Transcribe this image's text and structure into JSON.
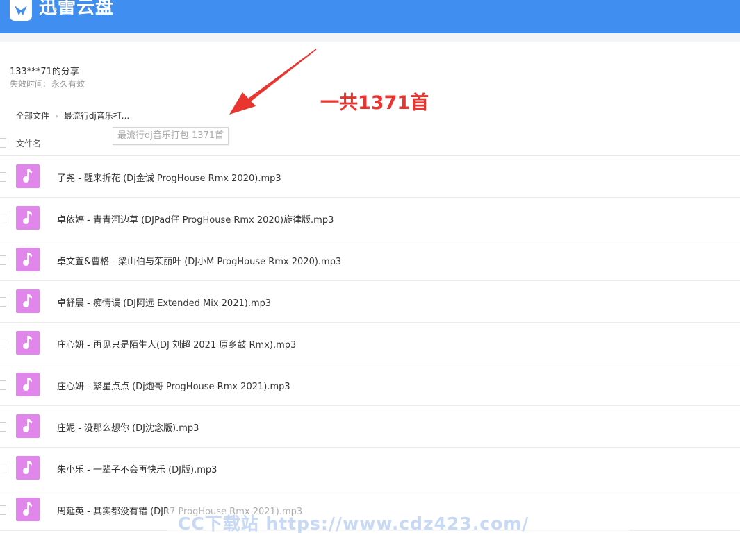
{
  "app": {
    "title": "迅雷云盘"
  },
  "share": {
    "owner_title": "133***71的分享",
    "expire_label": "失效时间:",
    "expire_value": "永久有效"
  },
  "annotation": {
    "text": "一共1371首",
    "color": "#e8352f"
  },
  "breadcrumb": {
    "root": "全部文件",
    "current": "最流行dj音乐打..."
  },
  "tooltip": {
    "text": "最流行dj音乐打包 1371首"
  },
  "list_header": {
    "name_col": "文件名"
  },
  "files": [
    {
      "name": "子尧 - 醒来折花 (Dj金诚 ProgHouse Rmx 2020).mp3"
    },
    {
      "name": "卓依婷 - 青青河边草 (DJPad仔 ProgHouse Rmx 2020)旋律版.mp3"
    },
    {
      "name": "卓文萱&曹格 - 梁山伯与茱丽叶 (DJ小M ProgHouse Rmx 2020).mp3"
    },
    {
      "name": "卓舒晨 - 痴情误 (DJ阿远 Extended Mix 2021).mp3"
    },
    {
      "name": "庄心妍 - 再见只是陌生人(DJ 刘超 2021 原乡鼓 Rmx).mp3"
    },
    {
      "name": "庄心妍 - 繁星点点 (Dj炮哥 ProgHouse Rmx 2021).mp3"
    },
    {
      "name": "庄妮 - 没那么想你 (DJ沈念版).mp3"
    },
    {
      "name": "朱小乐 - 一辈子不会再快乐 (DJ版).mp3"
    },
    {
      "name": "周延英 - 其实都没有错 (DJR7 ProgHouse Rmx 2021).mp3"
    }
  ],
  "watermark": {
    "text": "CC下载站 https://www.cdz423.com/"
  },
  "colors": {
    "topbar": "#3f8ef0",
    "music_icon": "#e186ea"
  }
}
